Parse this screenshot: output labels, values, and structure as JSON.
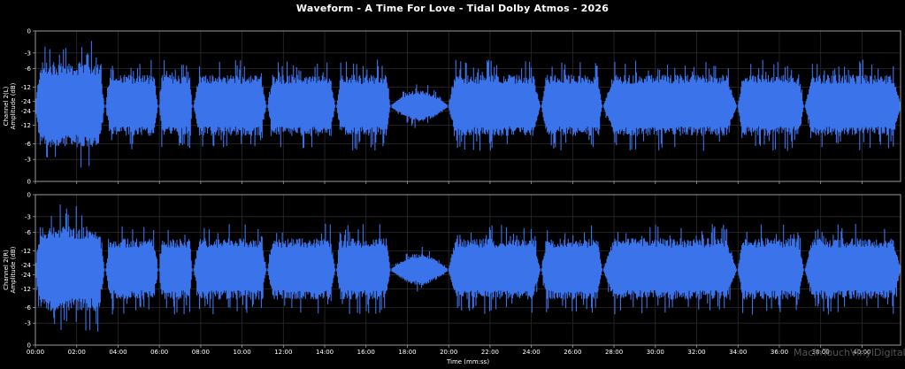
{
  "chart_data": {
    "type": "area",
    "title": "Waveform - A Time For Love - Tidal Dolby Atmos - 2026",
    "xlabel": "Time (mm:ss)",
    "x_range": [
      "00:00",
      "41:52"
    ],
    "x_ticks": [
      "00:00",
      "02:00",
      "04:00",
      "06:00",
      "08:00",
      "10:00",
      "12:00",
      "14:00",
      "16:00",
      "18:00",
      "20:00",
      "22:00",
      "24:00",
      "26:00",
      "28:00",
      "30:00",
      "32:00",
      "34:00",
      "36:00",
      "38:00",
      "40:00"
    ],
    "y_ticks": [
      "0",
      "-3",
      "-6",
      "-12",
      "-24",
      "-24",
      "-12",
      "-6",
      "-3",
      "0"
    ],
    "grid": true,
    "color": "#3a73ea",
    "series": [
      {
        "name": "Channel 2(L)",
        "ylabel": "Channel 2(L)",
        "ylabel2": "Amplitude (dB)",
        "segments": [
          {
            "start": "00:00",
            "end": "03:20",
            "peak_db": -3
          },
          {
            "start": "03:25",
            "end": "05:55",
            "peak_db": -6
          },
          {
            "start": "06:00",
            "end": "07:35",
            "peak_db": -6
          },
          {
            "start": "07:40",
            "end": "11:10",
            "peak_db": -6
          },
          {
            "start": "11:15",
            "end": "14:30",
            "peak_db": -6
          },
          {
            "start": "14:35",
            "end": "17:10",
            "peak_db": -6
          },
          {
            "start": "17:15",
            "end": "19:55",
            "peak_db": -12
          },
          {
            "start": "20:00",
            "end": "24:25",
            "peak_db": -6
          },
          {
            "start": "24:30",
            "end": "27:25",
            "peak_db": -6
          },
          {
            "start": "27:30",
            "end": "33:55",
            "peak_db": -6
          },
          {
            "start": "34:00",
            "end": "37:10",
            "peak_db": -6
          },
          {
            "start": "37:15",
            "end": "41:52",
            "peak_db": -6
          }
        ]
      },
      {
        "name": "Channel 2(R)",
        "ylabel": "Channel 2(R)",
        "ylabel2": "Amplitude (dB)",
        "segments": [
          {
            "start": "00:00",
            "end": "03:20",
            "peak_db": -3
          },
          {
            "start": "03:25",
            "end": "05:55",
            "peak_db": -6
          },
          {
            "start": "06:00",
            "end": "07:35",
            "peak_db": -6
          },
          {
            "start": "07:40",
            "end": "11:10",
            "peak_db": -6
          },
          {
            "start": "11:15",
            "end": "14:30",
            "peak_db": -6
          },
          {
            "start": "14:35",
            "end": "17:10",
            "peak_db": -6
          },
          {
            "start": "17:15",
            "end": "19:55",
            "peak_db": -12
          },
          {
            "start": "20:00",
            "end": "24:25",
            "peak_db": -6
          },
          {
            "start": "24:30",
            "end": "27:25",
            "peak_db": -6
          },
          {
            "start": "27:30",
            "end": "33:55",
            "peak_db": -6
          },
          {
            "start": "34:00",
            "end": "37:10",
            "peak_db": -6
          },
          {
            "start": "37:15",
            "end": "41:52",
            "peak_db": -6
          }
        ]
      }
    ]
  },
  "watermark": "MacInTouchVinylDigital.net"
}
